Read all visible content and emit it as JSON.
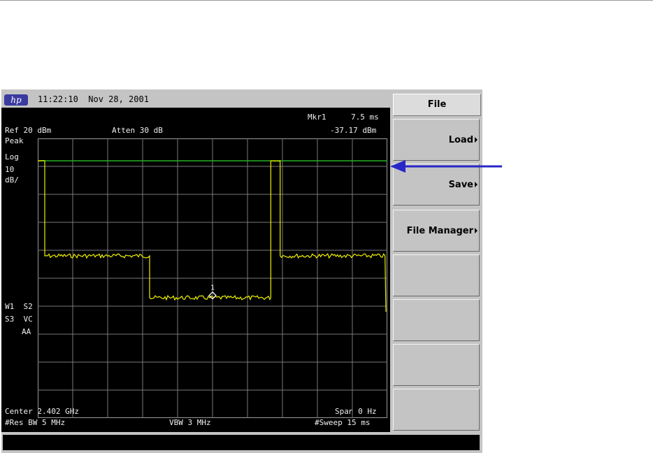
{
  "header": {
    "logo": "hp",
    "datetime": "11:22:10  Nov 28, 2001"
  },
  "annotations": {
    "ref": "Ref 20 dBm",
    "atten": "Atten 30 dB",
    "marker_label": "Mkr1",
    "marker_x": "7.5 ms",
    "marker_y": "-37.17 dBm",
    "detector": "Peak",
    "scale_type": "Log",
    "scale_value": "10",
    "scale_unit": "dB/",
    "w1s2": "W1  S2",
    "s3vc": "S3  VC",
    "aa": "AA",
    "center": "Center 2.402 GHz",
    "span": "Span 0 Hz",
    "res_bw": "#Res BW 5 MHz",
    "vbw": "VBW 3 MHz",
    "sweep": "#Sweep 15 ms",
    "marker_number": "1"
  },
  "softkeys": {
    "title": "File",
    "buttons": [
      "Load",
      "Save",
      "File Manager",
      "",
      "",
      "",
      ""
    ]
  },
  "colors": {
    "trace": "#f0f000",
    "threshold_line": "#22b422",
    "arrow": "#2828c8",
    "logo": "#3a3aa0"
  },
  "trace": {
    "x_unit": "ms",
    "y_unit": "dBm",
    "sweep_ms": 15,
    "ref_level_dbm": 20,
    "scale_db_per_div": 10,
    "display_line_dbm": 12,
    "segments": [
      {
        "x_start": 0.0,
        "x_end": 0.3,
        "level_dbm": 12
      },
      {
        "x_start": 0.3,
        "x_end": 4.8,
        "level_dbm": -22
      },
      {
        "x_start": 4.8,
        "x_end": 10.0,
        "level_dbm": -37
      },
      {
        "x_start": 10.0,
        "x_end": 10.4,
        "level_dbm": 12
      },
      {
        "x_start": 10.4,
        "x_end": 14.9,
        "level_dbm": -22
      }
    ],
    "marker": {
      "x": 7.5,
      "y": -37.17
    }
  }
}
